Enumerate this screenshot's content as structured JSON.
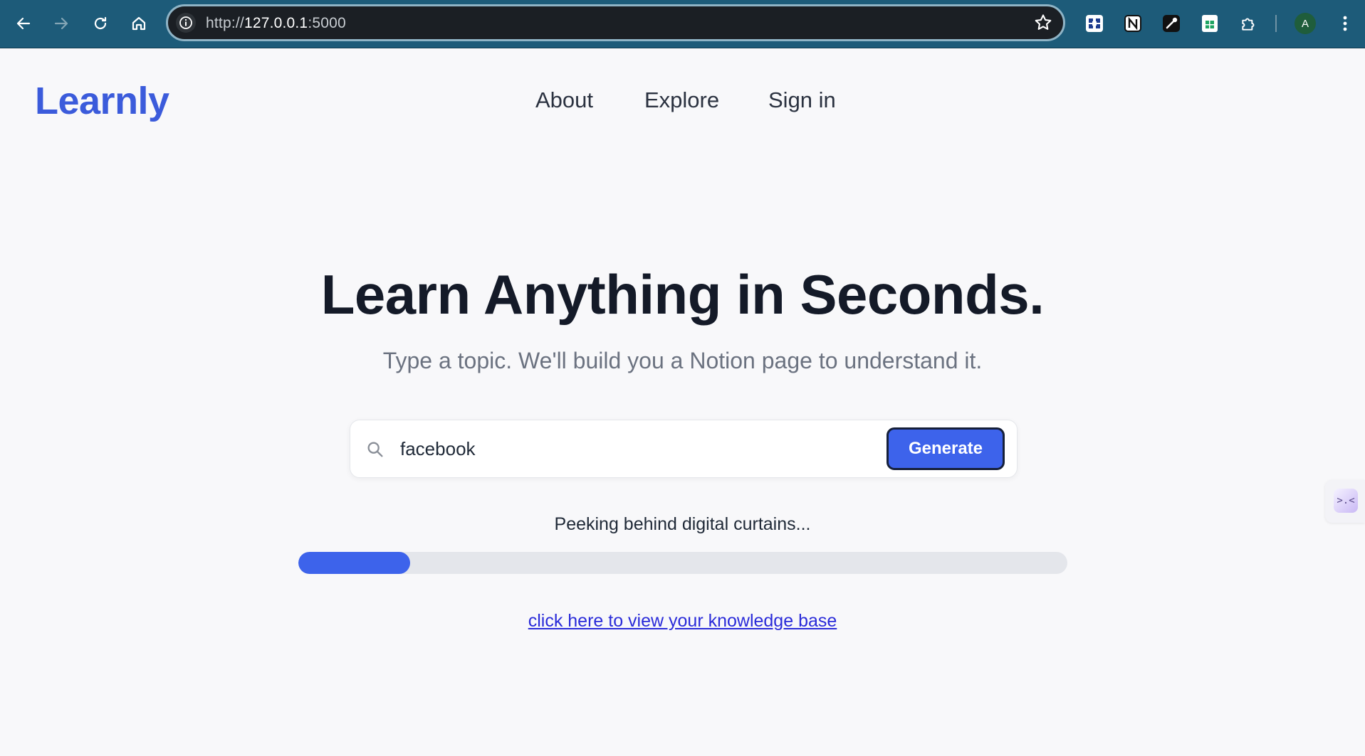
{
  "browser": {
    "url_scheme": "http://",
    "url_host": "127.0.0.1",
    "url_port": ":5000",
    "avatar_letter": "A",
    "toolbar_icons": [
      "back-icon",
      "forward-icon",
      "reload-icon",
      "home-icon"
    ],
    "extension_icons": [
      "extension-1-icon",
      "notion-icon",
      "eyedropper-icon",
      "sheets-icon",
      "extensions-puzzle-icon"
    ]
  },
  "header": {
    "logo": "Learnly",
    "nav": [
      {
        "label": "About"
      },
      {
        "label": "Explore"
      },
      {
        "label": "Sign in"
      }
    ]
  },
  "hero": {
    "title": "Learn Anything in Seconds.",
    "subtitle": "Type a topic. We'll build you a Notion page to understand it."
  },
  "search": {
    "value": "facebook",
    "placeholder": "",
    "button_label": "Generate"
  },
  "status": {
    "text": "Peeking behind digital curtains...",
    "progress_percent": 14.5
  },
  "link": {
    "label": "click here to view your knowledge base"
  },
  "colors": {
    "accent": "#3d63eb",
    "logo": "#3b5bdb",
    "chrome": "#1d5b79",
    "link": "#2a2bd9"
  }
}
